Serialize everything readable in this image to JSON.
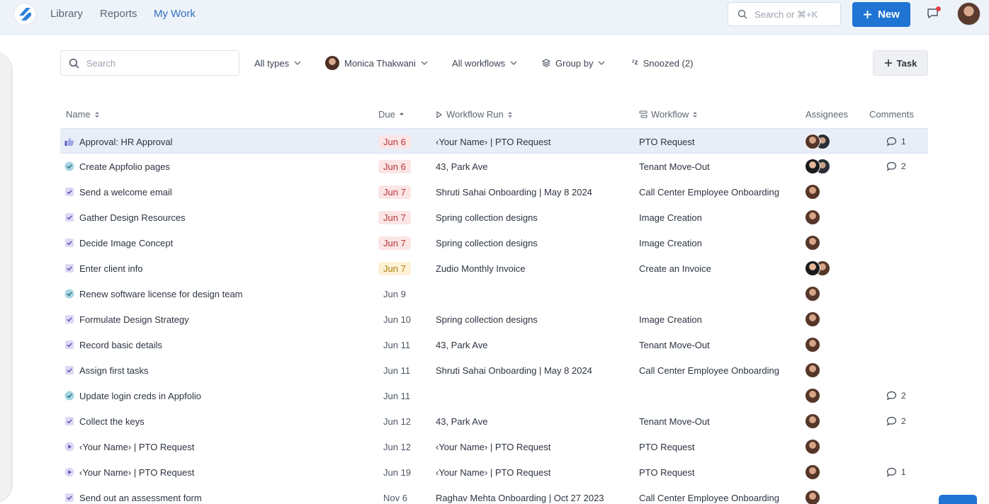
{
  "nav": {
    "library": "Library",
    "reports": "Reports",
    "my_work": "My Work",
    "search_placeholder": "Search or ⌘+K",
    "new_label": "New"
  },
  "filters": {
    "search_placeholder": "Search",
    "types": "All types",
    "user": "Monica Thakwani",
    "workflows": "All workflows",
    "group_by": "Group by",
    "snoozed": "Snoozed (2)",
    "task_button": "Task"
  },
  "columns": {
    "name": "Name",
    "due": "Due",
    "workflow_run": "Workflow Run",
    "workflow": "Workflow",
    "assignees": "Assignees",
    "comments": "Comments"
  },
  "colors": {
    "accent": "#1f74d4",
    "due_overdue_bg": "#fbe5e5",
    "due_overdue_text": "#b9363b",
    "due_soon_bg": "#fdf2d6",
    "due_soon_text": "#b27a0c",
    "selected_row": "#e8eef8"
  },
  "rows": [
    {
      "icon": "thumbs-up-icon",
      "name": "Approval: HR Approval",
      "due": "Jun 6",
      "due_state": "red",
      "run": "‹Your Name› | PTO Request",
      "workflow": "PTO Request",
      "assignees": [
        "a",
        "b"
      ],
      "comments": "1",
      "selected": true
    },
    {
      "icon": "check-circle-icon",
      "name": "Create Appfolio pages",
      "due": "Jun 6",
      "due_state": "red",
      "run": "43, Park Ave",
      "workflow": "Tenant Move-Out",
      "assignees": [
        "c",
        "b"
      ],
      "comments": "2"
    },
    {
      "icon": "checkbox-icon",
      "name": "Send a welcome email",
      "due": "Jun 7",
      "due_state": "red",
      "run": "Shruti Sahai Onboarding | May 8 2024",
      "workflow": "Call Center Employee Onboarding",
      "assignees": [
        "a"
      ],
      "comments": ""
    },
    {
      "icon": "checkbox-icon",
      "name": "Gather Design Resources",
      "due": "Jun 7",
      "due_state": "red",
      "run": "Spring collection designs",
      "workflow": "Image Creation",
      "assignees": [
        "a"
      ],
      "comments": ""
    },
    {
      "icon": "checkbox-icon",
      "name": "Decide Image Concept",
      "due": "Jun 7",
      "due_state": "red",
      "run": "Spring collection designs",
      "workflow": "Image Creation",
      "assignees": [
        "a"
      ],
      "comments": ""
    },
    {
      "icon": "checkbox-icon",
      "name": "Enter client info",
      "due": "Jun 7",
      "due_state": "yellow",
      "run": "Zudio Monthly Invoice",
      "workflow": "Create an Invoice",
      "assignees": [
        "c",
        "a"
      ],
      "comments": ""
    },
    {
      "icon": "check-circle-icon",
      "name": "Renew software license for design team",
      "due": "Jun 9",
      "due_state": "plain",
      "run": "",
      "workflow": "",
      "assignees": [
        "a"
      ],
      "comments": ""
    },
    {
      "icon": "checkbox-icon",
      "name": "Formulate Design Strategy",
      "due": "Jun 10",
      "due_state": "plain",
      "run": "Spring collection designs",
      "workflow": "Image Creation",
      "assignees": [
        "a"
      ],
      "comments": ""
    },
    {
      "icon": "checkbox-icon",
      "name": "Record basic details",
      "due": "Jun 11",
      "due_state": "plain",
      "run": "43, Park Ave",
      "workflow": "Tenant Move-Out",
      "assignees": [
        "a"
      ],
      "comments": ""
    },
    {
      "icon": "checkbox-icon",
      "name": "Assign first tasks",
      "due": "Jun 11",
      "due_state": "plain",
      "run": "Shruti Sahai Onboarding | May 8 2024",
      "workflow": "Call Center Employee Onboarding",
      "assignees": [
        "a"
      ],
      "comments": ""
    },
    {
      "icon": "check-circle-icon",
      "name": "Update login creds in Appfolio",
      "due": "Jun 11",
      "due_state": "plain",
      "run": "",
      "workflow": "",
      "assignees": [
        "a"
      ],
      "comments": "2"
    },
    {
      "icon": "checkbox-icon",
      "name": "Collect the keys",
      "due": "Jun 12",
      "due_state": "plain",
      "run": "43, Park Ave",
      "workflow": "Tenant Move-Out",
      "assignees": [
        "a"
      ],
      "comments": "2"
    },
    {
      "icon": "play-circle-icon",
      "name": "‹Your Name› | PTO Request",
      "due": "Jun 12",
      "due_state": "plain",
      "run": "‹Your Name› | PTO Request",
      "workflow": "PTO Request",
      "assignees": [
        "a"
      ],
      "comments": ""
    },
    {
      "icon": "play-circle-icon",
      "name": "‹Your Name› | PTO Request",
      "due": "Jun 19",
      "due_state": "plain",
      "run": "‹Your Name› | PTO Request",
      "workflow": "PTO Request",
      "assignees": [
        "a"
      ],
      "comments": "1"
    },
    {
      "icon": "checkbox-icon",
      "name": "Send out an assessment form",
      "due": "Nov 6",
      "due_state": "plain",
      "run": "Raghav Mehta Onboarding | Oct 27 2023",
      "workflow": "Call Center Employee Onboarding",
      "assignees": [
        "a"
      ],
      "comments": ""
    }
  ]
}
